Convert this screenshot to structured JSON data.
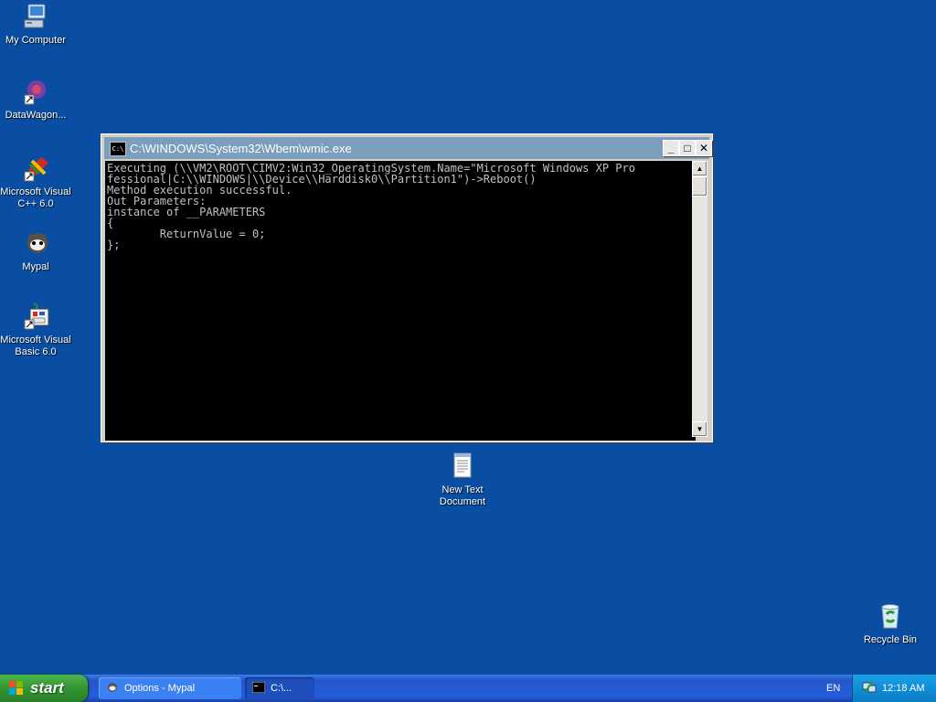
{
  "desktop": {
    "icons": [
      {
        "label": "My Computer",
        "icon": "my-computer-icon"
      },
      {
        "label": "DataWagon...",
        "icon": "datawagon-icon"
      },
      {
        "label": "Microsoft Visual C++ 6.0",
        "icon": "visual-cpp-icon"
      },
      {
        "label": "Mypal",
        "icon": "mypal-icon"
      },
      {
        "label": "Microsoft Visual Basic 6.0",
        "icon": "visual-basic-icon"
      },
      {
        "label": "New Text Document",
        "icon": "text-document-icon"
      },
      {
        "label": "Recycle Bin",
        "icon": "recycle-bin-icon"
      }
    ]
  },
  "window": {
    "title": "C:\\WINDOWS\\System32\\Wbem\\wmic.exe",
    "icon_text": "C:\\",
    "buttons": {
      "minimize": "_",
      "maximize": "□",
      "close": "✕"
    },
    "console_text": "Executing (\\\\VM2\\ROOT\\CIMV2:Win32_OperatingSystem.Name=\"Microsoft Windows XP Pro\nfessional|C:\\\\WINDOWS|\\\\Device\\\\Harddisk0\\\\Partition1\")->Reboot()\nMethod execution successful.\nOut Parameters:\ninstance of __PARAMETERS\n{\n        ReturnValue = 0;\n};"
  },
  "taskbar": {
    "start_label": "start",
    "tasks": [
      {
        "label": "Options - Mypal",
        "active": false
      },
      {
        "label": "C:\\...",
        "active": true
      }
    ],
    "language": "EN",
    "clock": "12:18 AM"
  },
  "colors": {
    "desktop": "#0a4ea3",
    "titlebar_inactive": "#7b9ebd",
    "start_green": "#3a9e3a",
    "tray_blue": "#0f8ed8"
  }
}
